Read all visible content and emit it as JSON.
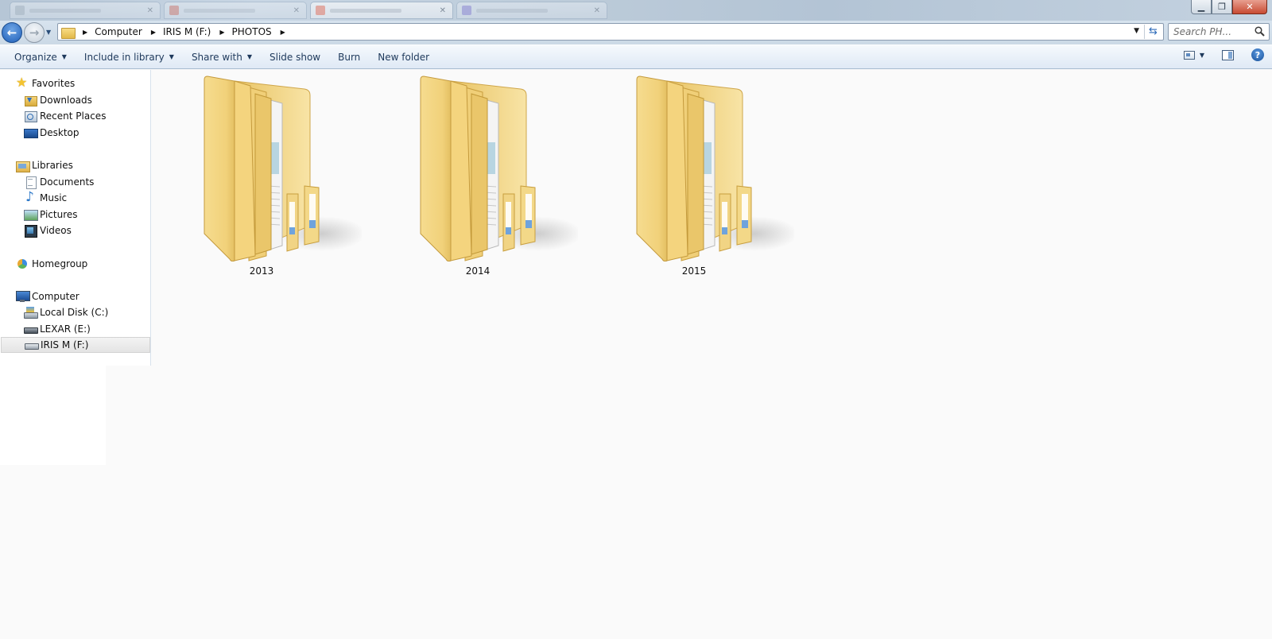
{
  "window": {
    "controls": {
      "minimize": "▁",
      "maximize": "❐",
      "close": "✕"
    }
  },
  "address": {
    "crumbs": [
      "Computer",
      "IRIS M (F:)",
      "PHOTOS"
    ],
    "search_placeholder": "Search PH..."
  },
  "toolbar": {
    "organize": "Organize",
    "include_in_library": "Include in library",
    "share_with": "Share with",
    "slide_show": "Slide show",
    "burn": "Burn",
    "new_folder": "New folder",
    "help": "?"
  },
  "nav": {
    "favorites": {
      "label": "Favorites",
      "items": [
        "Downloads",
        "Recent Places",
        "Desktop"
      ]
    },
    "libraries": {
      "label": "Libraries",
      "items": [
        "Documents",
        "Music",
        "Pictures",
        "Videos"
      ]
    },
    "homegroup": {
      "label": "Homegroup"
    },
    "computer": {
      "label": "Computer",
      "items": [
        "Local Disk (C:)",
        "LEXAR (E:)",
        "IRIS M (F:)"
      ]
    },
    "selected": "IRIS M (F:)"
  },
  "content": {
    "folders": [
      "2013",
      "2014",
      "2015"
    ]
  },
  "colors": {
    "folder_light": "#f9e39a",
    "folder_dark": "#e3bd58",
    "accent": "#1e395b"
  }
}
